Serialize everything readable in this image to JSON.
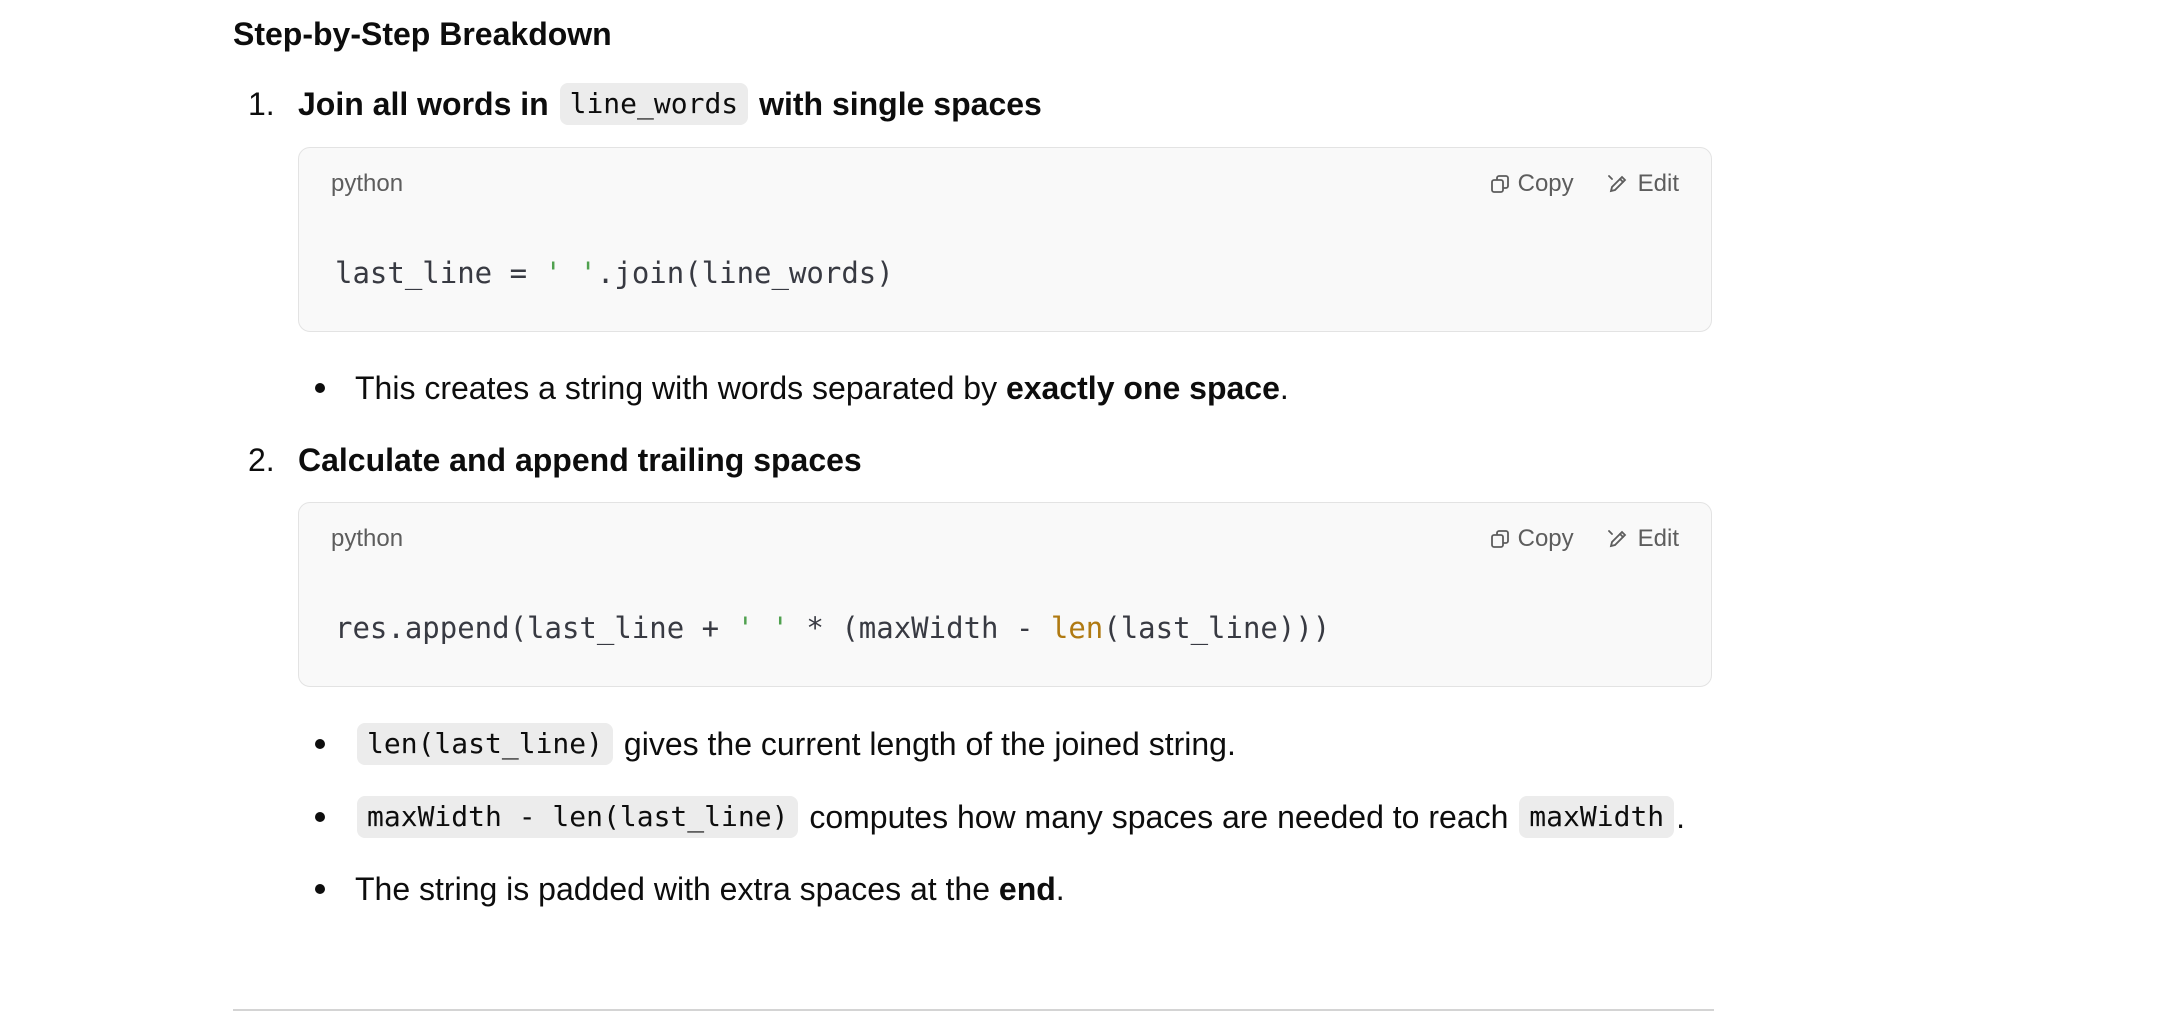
{
  "section": {
    "title": "Step-by-Step Breakdown"
  },
  "steps": [
    {
      "number": "1.",
      "title_before": "Join all words in ",
      "title_code": "line_words",
      "title_after": " with single spaces",
      "code": {
        "language": "python",
        "copy_label": "Copy",
        "edit_label": "Edit",
        "line_part1": "last_line = ",
        "line_str": "' '",
        "line_part2": ".join(line_words)"
      },
      "bullets": [
        {
          "text_before": "This creates a string with words separated by ",
          "bold": "exactly one space",
          "text_after": "."
        }
      ]
    },
    {
      "number": "2.",
      "title": "Calculate and append trailing spaces",
      "code": {
        "language": "python",
        "copy_label": "Copy",
        "edit_label": "Edit",
        "line_part1": "res.append(last_line + ",
        "line_str": "' '",
        "line_part2": " * (maxWidth - ",
        "line_builtin": "len",
        "line_part3": "(last_line)))"
      },
      "bullets": [
        {
          "code": "len(last_line)",
          "text_after": " gives the current length of the joined string."
        },
        {
          "code": "maxWidth - len(last_line)",
          "text_middle": " computes how many spaces are needed to reach ",
          "code2": "maxWidth",
          "text_after": "."
        },
        {
          "text_before": "The string is padded with extra spaces at the ",
          "bold": "end",
          "text_after": "."
        }
      ]
    }
  ],
  "icons": {
    "copy": "copy-icon",
    "edit": "edit-icon"
  }
}
